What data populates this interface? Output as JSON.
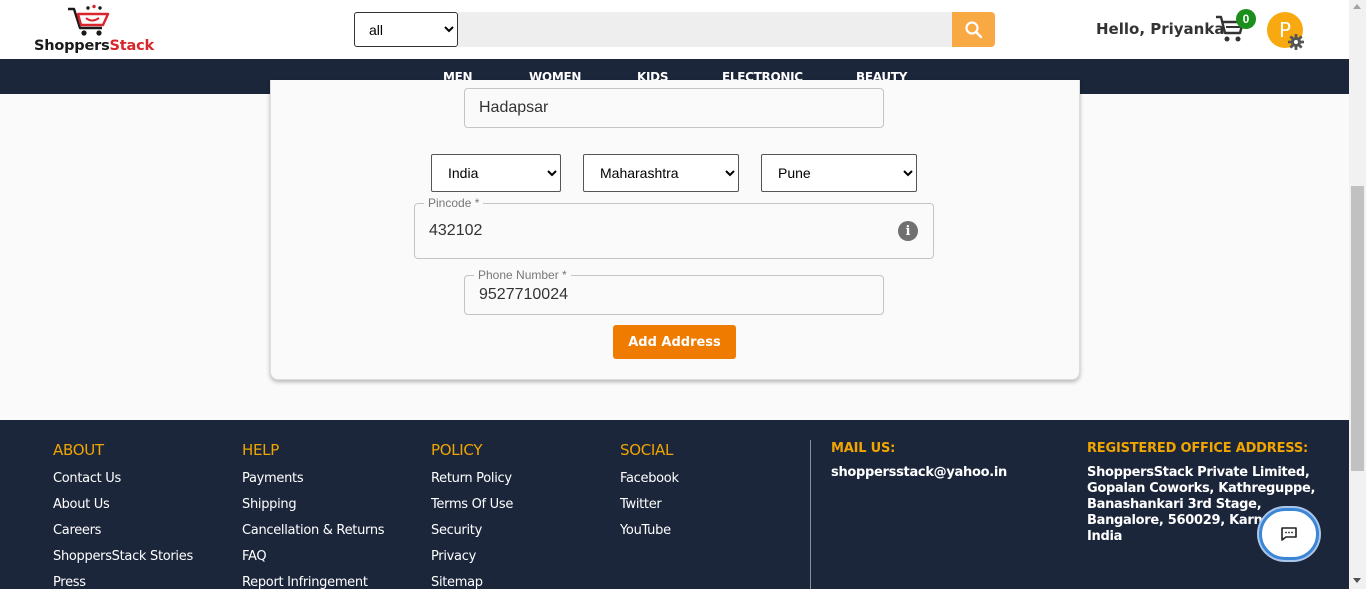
{
  "header": {
    "logo_text_1": "Shoppers",
    "logo_text_2": "Stack",
    "category_selected": "all",
    "search_value": "",
    "greeting": "Hello, Priyanka",
    "cart_count": "0",
    "avatar_letter": "P"
  },
  "nav": {
    "items": [
      "MEN",
      "WOMEN",
      "KIDS",
      "ELECTRONIC",
      "BEAUTY"
    ]
  },
  "form": {
    "area_value": "Hadapsar",
    "country_selected": "India",
    "state_selected": "Maharashtra",
    "city_selected": "Pune",
    "pincode_label": "Pincode *",
    "pincode_value": "432102",
    "phone_label": "Phone Number *",
    "phone_value": "9527710024",
    "submit_label": "Add Address"
  },
  "footer": {
    "about": {
      "heading": "ABOUT",
      "links": [
        "Contact Us",
        "About Us",
        "Careers",
        "ShoppersStack Stories",
        "Press"
      ]
    },
    "help": {
      "heading": "HELP",
      "links": [
        "Payments",
        "Shipping",
        "Cancellation & Returns",
        "FAQ",
        "Report Infringement"
      ]
    },
    "policy": {
      "heading": "POLICY",
      "links": [
        "Return Policy",
        "Terms Of Use",
        "Security",
        "Privacy",
        "Sitemap"
      ]
    },
    "social": {
      "heading": "SOCIAL",
      "links": [
        "Facebook",
        "Twitter",
        "YouTube"
      ]
    },
    "mail": {
      "heading": "MAIL US:",
      "email": "shoppersstack@yahoo.in"
    },
    "office": {
      "heading": "REGISTERED OFFICE ADDRESS:",
      "lines": [
        "ShoppersStack Private Limited,",
        "Gopalan Coworks, Kathreguppe,",
        "Banashankari 3rd Stage,",
        "Bangalore, 560029, Karnataka,",
        "India"
      ]
    }
  },
  "colors": {
    "navy": "#1b263b",
    "accent_orange": "#ef7c00",
    "search_orange": "#f8a944",
    "footer_heading": "#f0a500",
    "cart_badge": "#1b8f1b",
    "avatar": "#f8a90f"
  },
  "icons": {
    "logo": "cart-logo-icon",
    "search": "search-icon",
    "cart": "cart-icon",
    "settings": "gear-icon",
    "info": "info-icon",
    "chat": "chat-icon"
  }
}
